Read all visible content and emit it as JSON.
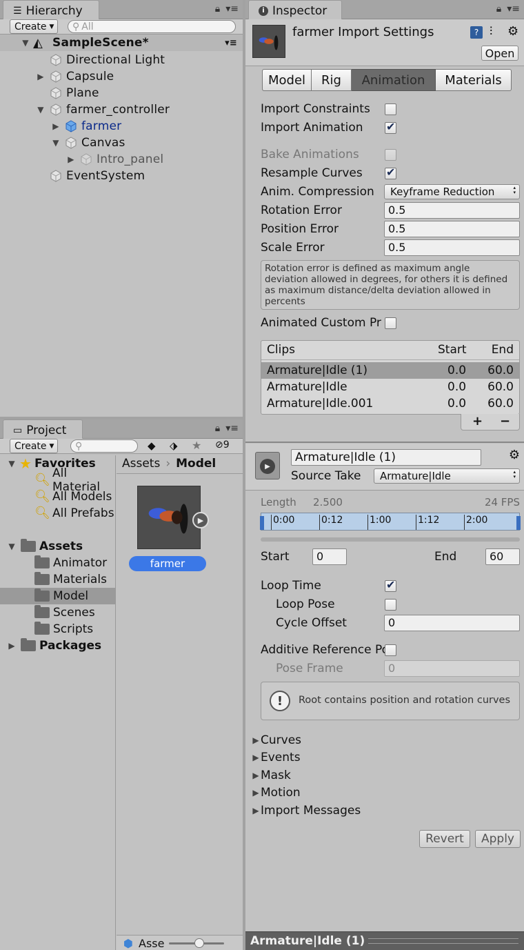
{
  "hierarchy": {
    "tab_title": "Hierarchy",
    "create_label": "Create",
    "search_placeholder": "All",
    "scene_name": "SampleScene*",
    "items": [
      {
        "label": "Directional Light"
      },
      {
        "label": "Capsule"
      },
      {
        "label": "Plane"
      },
      {
        "label": "farmer_controller"
      },
      {
        "label": "farmer"
      },
      {
        "label": "Canvas"
      },
      {
        "label": "Intro_panel"
      },
      {
        "label": "EventSystem"
      }
    ]
  },
  "project": {
    "tab_title": "Project",
    "create_label": "Create",
    "hidden_count": "9",
    "tree": [
      {
        "label": "Favorites"
      },
      {
        "label": "All Material"
      },
      {
        "label": "All Models"
      },
      {
        "label": "All Prefabs"
      },
      {
        "label": "Assets"
      },
      {
        "label": "Animator"
      },
      {
        "label": "Materials"
      },
      {
        "label": "Model"
      },
      {
        "label": "Scenes"
      },
      {
        "label": "Scripts"
      },
      {
        "label": "Packages"
      }
    ],
    "breadcrumb": {
      "root": "Assets",
      "current": "Model"
    },
    "asset_label": "farmer",
    "footer_label": "Asse"
  },
  "inspector": {
    "tab_title": "Inspector",
    "title": "farmer Import Settings",
    "open_label": "Open",
    "tabs": [
      "Model",
      "Rig",
      "Animation",
      "Materials"
    ],
    "import_constraints_label": "Import Constraints",
    "import_animation_label": "Import Animation",
    "bake_animations_label": "Bake Animations",
    "resample_curves_label": "Resample Curves",
    "anim_compression_label": "Anim. Compression",
    "anim_compression_value": "Keyframe Reduction",
    "rotation_error_label": "Rotation Error",
    "rotation_error_value": "0.5",
    "position_error_label": "Position Error",
    "position_error_value": "0.5",
    "scale_error_label": "Scale Error",
    "scale_error_value": "0.5",
    "help_text": "Rotation error is defined as maximum angle deviation allowed in degrees, for others it is defined as maximum distance/delta deviation allowed in percents",
    "animated_custom_label": "Animated Custom Pr",
    "clips_header": {
      "name": "Clips",
      "start": "Start",
      "end": "End"
    },
    "clips": [
      {
        "name": "Armature|Idle (1)",
        "start": "0.0",
        "end": "60.0"
      },
      {
        "name": "Armature|Idle",
        "start": "0.0",
        "end": "60.0"
      },
      {
        "name": "Armature|Idle.001",
        "start": "0.0",
        "end": "60.0"
      }
    ],
    "add_label": "+",
    "remove_label": "−",
    "clip_name_value": "Armature|Idle (1)",
    "source_take_label": "Source Take",
    "source_take_value": "Armature|Idle",
    "length_label": "Length",
    "length_value": "2.500",
    "fps_label": "24 FPS",
    "timeline_ticks": [
      "0:00",
      "0:12",
      "1:00",
      "1:12",
      "2:00"
    ],
    "start_label": "Start",
    "start_value": "0",
    "end_label": "End",
    "end_value": "60",
    "loop_time_label": "Loop Time",
    "loop_pose_label": "Loop Pose",
    "cycle_offset_label": "Cycle Offset",
    "cycle_offset_value": "0",
    "additive_label": "Additive Reference Po",
    "pose_frame_label": "Pose Frame",
    "pose_frame_value": "0",
    "warning_text": "Root contains position and rotation curves",
    "sections": [
      "Curves",
      "Events",
      "Mask",
      "Motion",
      "Import Messages"
    ],
    "revert_label": "Revert",
    "apply_label": "Apply",
    "preview_title": "Armature|Idle (1)"
  },
  "colors": {
    "selection_blue": "#3b78e7",
    "accent_dark": "#1a2b55"
  }
}
